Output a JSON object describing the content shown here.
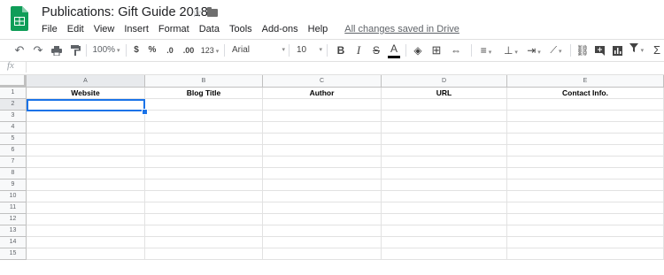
{
  "doc": {
    "title": "Publications: Gift Guide 2018"
  },
  "menu": [
    "File",
    "Edit",
    "View",
    "Insert",
    "Format",
    "Data",
    "Tools",
    "Add-ons",
    "Help"
  ],
  "status": "All changes saved in Drive",
  "toolbar": {
    "zoom": "100%",
    "currency": "$",
    "percent": "%",
    "dec_less": ".0",
    "dec_more": ".00",
    "more_formats": "123",
    "font": "Arial",
    "size": "10",
    "bold": "B",
    "italic": "I",
    "strike": "S",
    "text_color": "A"
  },
  "formula": {
    "fx": "fx"
  },
  "columns": [
    "A",
    "B",
    "C",
    "D",
    "E"
  ],
  "rows": [
    "1",
    "2",
    "3",
    "4",
    "5",
    "6",
    "7",
    "8",
    "9",
    "10",
    "11",
    "12",
    "13",
    "14",
    "15"
  ],
  "header_row": [
    "Website",
    "Blog Title",
    "Author",
    "URL",
    "Contact Info."
  ],
  "selected_cell": "A2",
  "colors": {
    "accent": "#1a73e8",
    "sheets_green": "#0f9d58"
  }
}
